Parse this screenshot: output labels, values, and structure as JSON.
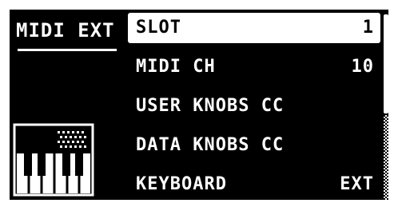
{
  "tab": {
    "title": "MIDI EXT"
  },
  "menu": {
    "items": [
      {
        "label": "SLOT",
        "value": "1",
        "selected": true
      },
      {
        "label": "MIDI CH",
        "value": "10",
        "selected": false
      },
      {
        "label": "USER KNOBS CC",
        "value": "",
        "selected": false
      },
      {
        "label": "DATA KNOBS CC",
        "value": "",
        "selected": false
      },
      {
        "label": "KEYBOARD",
        "value": "EXT",
        "selected": false
      }
    ]
  },
  "scrollbar": {
    "position": 0,
    "visible_fraction": 0.54
  },
  "icons": {
    "keyboard": "keyboard-icon"
  },
  "colors": {
    "background": "#000000",
    "foreground": "#ffffff",
    "selected_bg": "#ffffff",
    "selected_fg": "#000000"
  }
}
